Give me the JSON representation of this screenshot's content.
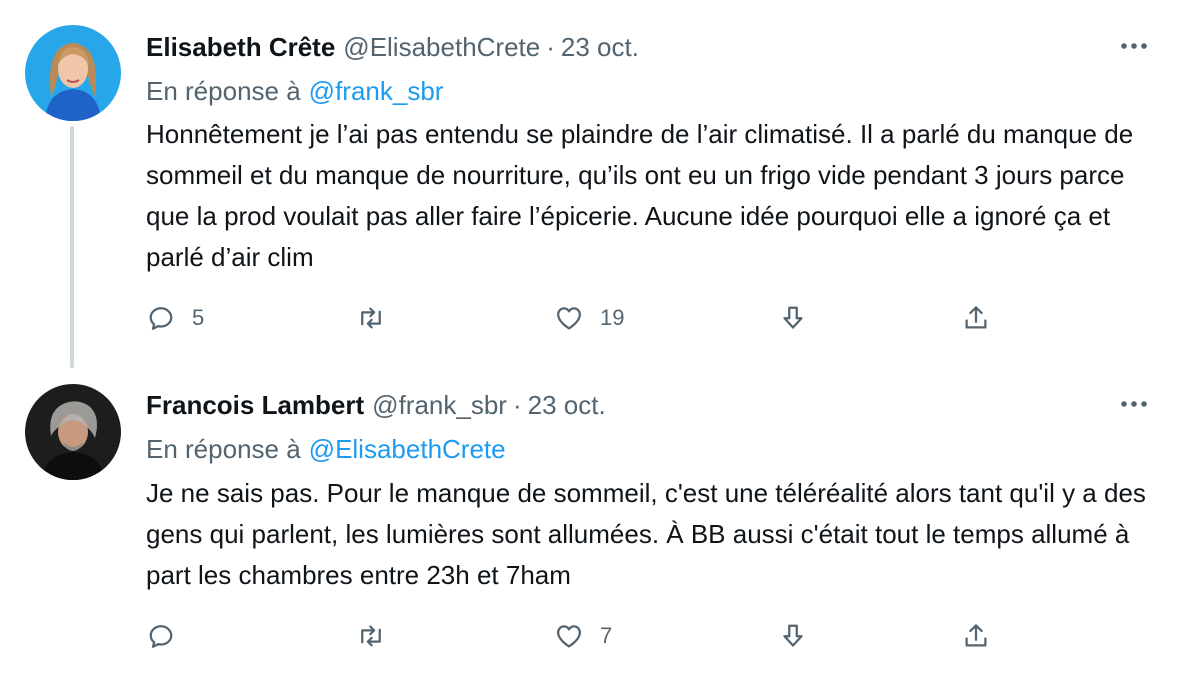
{
  "tweets": [
    {
      "author": {
        "name": "Elisabeth Crête",
        "handle": "@ElisabethCrete",
        "avatar": "avatar-woman-blonde-blue-shirt"
      },
      "separator": "·",
      "date": "23 oct.",
      "reply_prefix": "En réponse à",
      "reply_to": "@frank_sbr",
      "text": "Honnêtement je l’ai pas entendu se plaindre de l’air climatisé. Il a parlé du manque de sommeil et du manque de nourriture, qu’ils ont eu un frigo vide pendant 3 jours parce que la prod voulait pas aller faire l’épicerie. Aucune idée pourquoi elle a ignoré ça et parlé d’air clim",
      "actions": {
        "reply_count": "5",
        "retweet_count": "",
        "like_count": "19"
      }
    },
    {
      "author": {
        "name": "Francois Lambert",
        "handle": "@frank_sbr",
        "avatar": "avatar-man-grey-hair-dark"
      },
      "separator": "·",
      "date": "23 oct.",
      "reply_prefix": "En réponse à",
      "reply_to": "@ElisabethCrete",
      "text": "Je ne sais pas. Pour le manque de sommeil, c'est une téléréalité alors tant qu'il y a des gens qui parlent, les lumières sont allumées. À BB aussi c'était tout le temps allumé à part les chambres entre 23h et 7ham",
      "actions": {
        "reply_count": "",
        "retweet_count": "",
        "like_count": "7"
      }
    }
  ],
  "icons": [
    "more-icon",
    "reply-icon",
    "retweet-icon",
    "like-icon",
    "downvote-icon",
    "share-icon"
  ],
  "colors": {
    "text": "#0f1419",
    "secondary": "#536471",
    "link": "#1d9bf0",
    "thread_line": "#cfd9de"
  }
}
